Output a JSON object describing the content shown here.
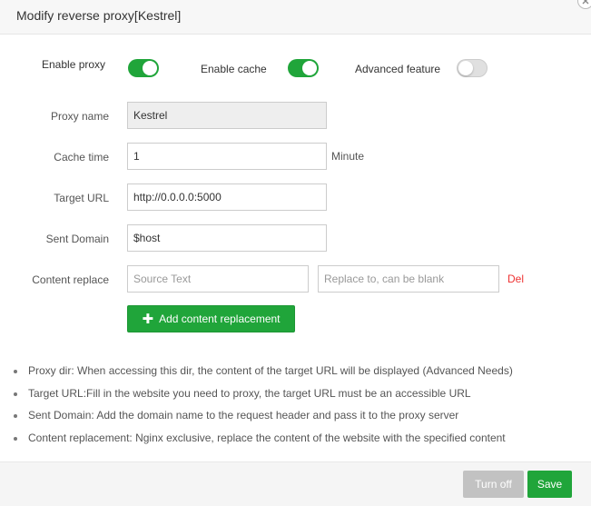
{
  "dialog": {
    "title": "Modify reverse proxy[Kestrel]"
  },
  "toggles": {
    "enable_proxy": {
      "label": "Enable proxy",
      "on": true
    },
    "enable_cache": {
      "label": "Enable cache",
      "on": true
    },
    "advanced_feature": {
      "label": "Advanced feature",
      "on": false
    }
  },
  "fields": {
    "proxy_name": {
      "label": "Proxy name",
      "value": "Kestrel"
    },
    "cache_time": {
      "label": "Cache time",
      "value": "1",
      "unit": "Minute"
    },
    "target_url": {
      "label": "Target URL",
      "value": "http://0.0.0.0:5000"
    },
    "sent_domain": {
      "label": "Sent Domain",
      "value": "$host"
    },
    "content_replace": {
      "label": "Content replace",
      "source_placeholder": "Source Text",
      "replace_placeholder": "Replace to, can be blank",
      "delete_label": "Del"
    }
  },
  "add_button": {
    "label": "Add content replacement"
  },
  "tips": [
    "Proxy dir: When accessing this dir, the content of the target URL will be displayed (Advanced Needs)",
    "Target URL:Fill in the website you need to proxy, the target URL must be an accessible URL",
    "Sent Domain: Add the domain name to the request header and pass it to the proxy server",
    "Content replacement: Nginx exclusive, replace the content of the website with the specified content"
  ],
  "footer": {
    "turn_off_label": "Turn off",
    "save_label": "Save"
  },
  "colors": {
    "accent": "#20a53a",
    "danger": "#ee3333",
    "disabled": "#c2c2c2"
  }
}
